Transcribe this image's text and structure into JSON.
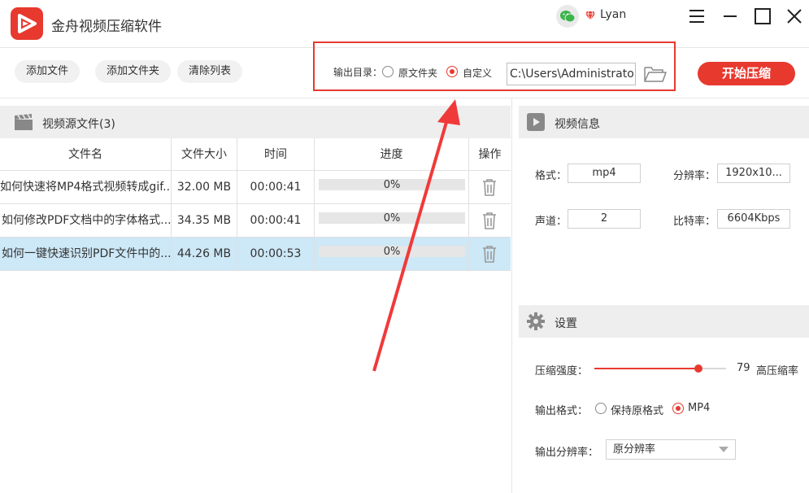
{
  "app": {
    "title": "金舟视频压缩软件",
    "username": "Lyan"
  },
  "colors": {
    "accent": "#e8392f",
    "selected_row": "#cde8f7",
    "section_bg": "#eeeeee"
  },
  "toolbar": {
    "add_file": "添加文件",
    "add_folder": "添加文件夹",
    "clear_list": "清除列表",
    "output_dir_label": "输出目录：",
    "option_original": "原文件夹",
    "option_custom": "自定义",
    "output_path": "C:\\Users\\Administrator\\",
    "start_label": "开始压缩"
  },
  "source_panel": {
    "title": "视频源文件(3)",
    "columns": [
      "文件名",
      "文件大小",
      "时间",
      "进度",
      "操作"
    ],
    "rows": [
      {
        "name": "如何快速将MP4格式视频转成gif...",
        "size": "32.00 MB",
        "time": "00:00:41",
        "progress": "0%"
      },
      {
        "name": "如何修改PDF文档中的字体格式...",
        "size": "34.35 MB",
        "time": "00:00:41",
        "progress": "0%"
      },
      {
        "name": "如何一键快速识别PDF文件中的...",
        "size": "44.26 MB",
        "time": "00:00:53",
        "progress": "0%"
      }
    ]
  },
  "video_info": {
    "title": "视频信息",
    "format_label": "格式：",
    "format_value": "mp4",
    "resolution_label": "分辨率：",
    "resolution_value": "1920x10...",
    "channel_label": "声道：",
    "channel_value": "2",
    "bitrate_label": "比特率：",
    "bitrate_value": "6604Kbps"
  },
  "settings": {
    "title": "设置",
    "strength_label": "压缩强度：",
    "strength_value": 79,
    "strength_value_text": "79",
    "strength_desc": "高压缩率",
    "output_format_label": "输出格式：",
    "format_keep": "保持原格式",
    "format_mp4": "MP4",
    "output_resolution_label": "输出分辨率：",
    "output_resolution_value": "原分辨率"
  }
}
